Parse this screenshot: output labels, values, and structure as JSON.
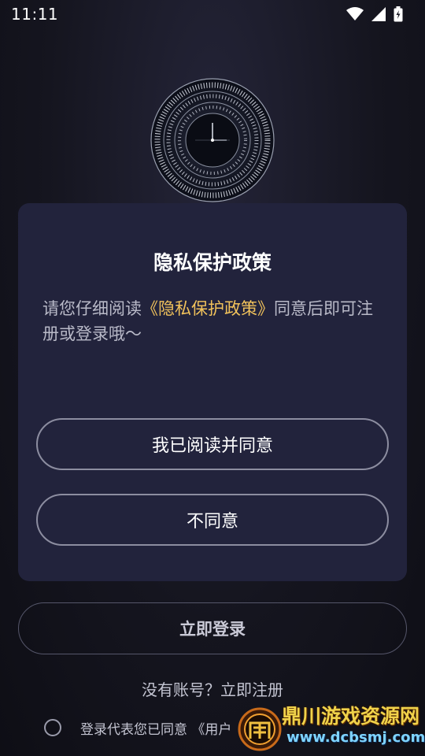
{
  "status_bar": {
    "time": "11:11"
  },
  "dialog": {
    "title": "隐私保护政策",
    "body_prefix": "请您仔细阅读",
    "policy_link": "《隐私保护政策》",
    "body_suffix": "同意后即可注册或登录哦～",
    "agree_button": "我已阅读并同意",
    "disagree_button": "不同意"
  },
  "login": {
    "button_label": "立即登录"
  },
  "register": {
    "text": "没有账号？立即注册"
  },
  "consent": {
    "text": "登录代表您已同意 《用户"
  },
  "watermark": {
    "title": "鼎川游戏资源网",
    "url": "www.dcbsmj.com"
  },
  "colors": {
    "background": "#15151f",
    "dialog": "#22233c",
    "link": "#f1c25b",
    "button_border": "#8c8da0"
  }
}
